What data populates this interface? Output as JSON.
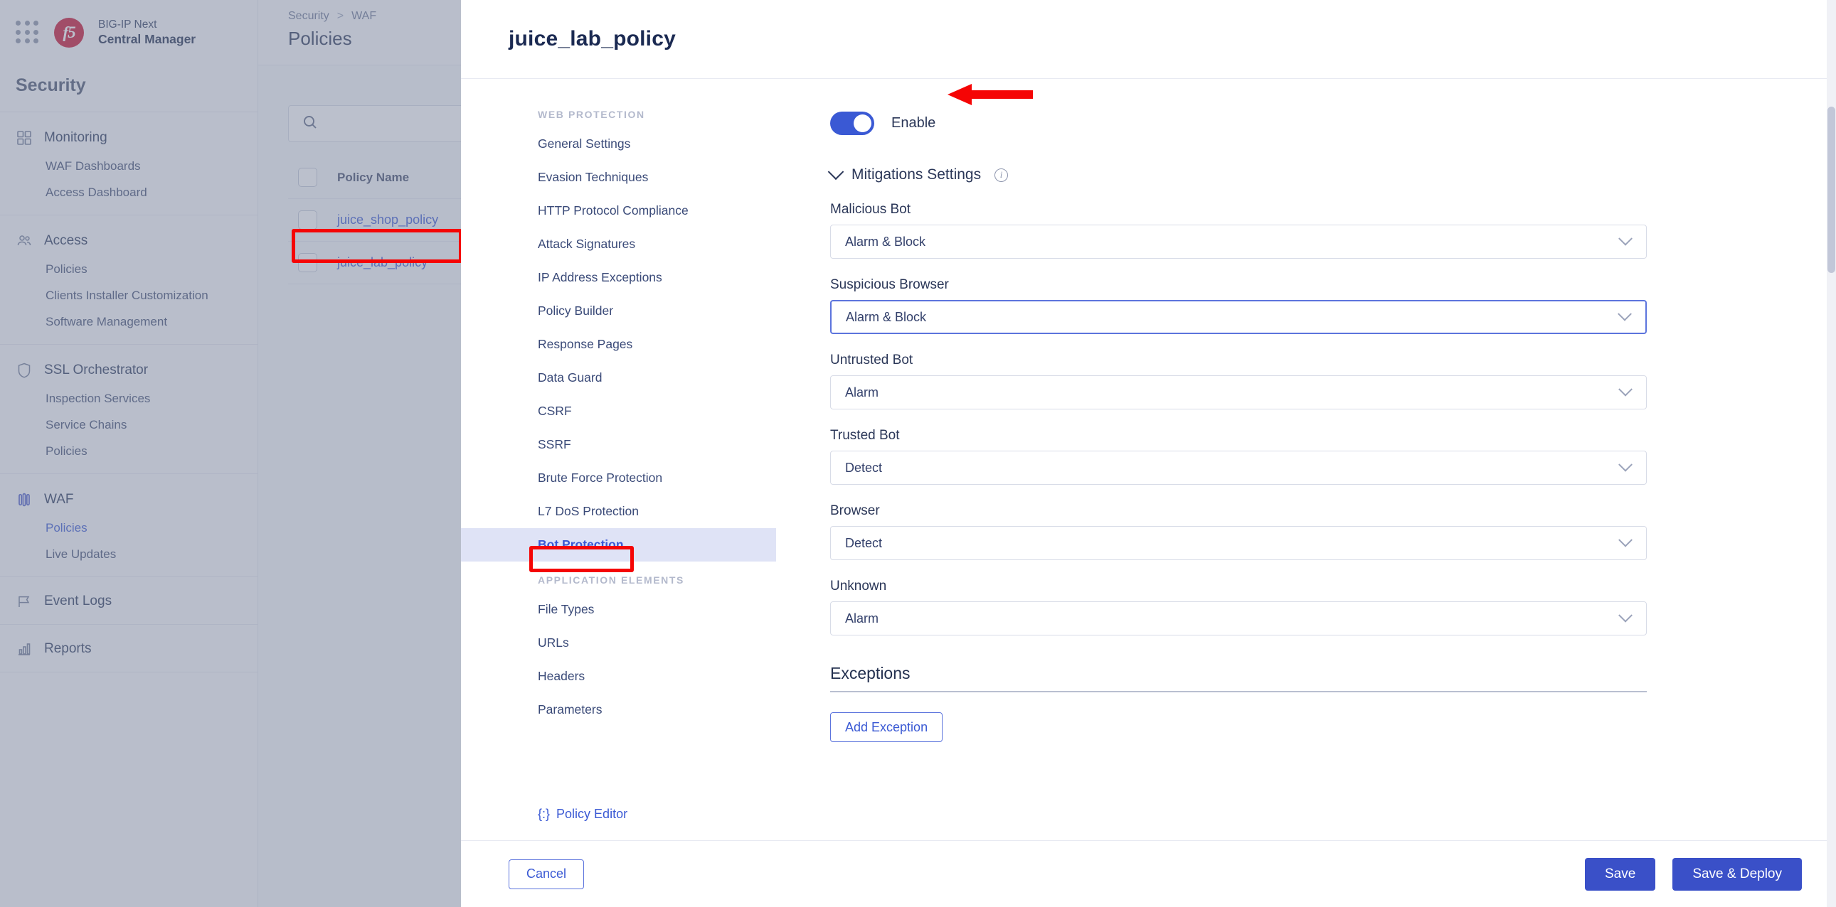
{
  "brand": {
    "logo": "f5",
    "line1": "BIG-IP Next",
    "line2": "Central Manager"
  },
  "sidebar": {
    "title": "Security",
    "groups": [
      {
        "icon": "grid-icon",
        "label": "Monitoring",
        "items": [
          {
            "label": "WAF Dashboards",
            "active": false
          },
          {
            "label": "Access Dashboard",
            "active": false
          }
        ]
      },
      {
        "icon": "users-icon",
        "label": "Access",
        "items": [
          {
            "label": "Policies",
            "active": false
          },
          {
            "label": "Clients Installer Customization",
            "active": false
          },
          {
            "label": "Software Management",
            "active": false
          }
        ]
      },
      {
        "icon": "shield-icon",
        "label": "SSL Orchestrator",
        "items": [
          {
            "label": "Inspection Services",
            "active": false
          },
          {
            "label": "Service Chains",
            "active": false
          },
          {
            "label": "Policies",
            "active": false
          }
        ]
      },
      {
        "icon": "waf-icon",
        "label": "WAF",
        "items": [
          {
            "label": "Policies",
            "active": true
          },
          {
            "label": "Live Updates",
            "active": false
          }
        ]
      },
      {
        "icon": "flag-icon",
        "label": "Event Logs",
        "items": []
      },
      {
        "icon": "bar-chart-icon",
        "label": "Reports",
        "items": []
      }
    ]
  },
  "background_page": {
    "breadcrumb": [
      "Security",
      "WAF"
    ],
    "breadcrumb_separator": ">",
    "page_title": "Policies",
    "search": {
      "value": "",
      "placeholder": "",
      "icon": "search-icon"
    },
    "table": {
      "columns": [
        "Policy Name"
      ],
      "rows": [
        {
          "name": "juice_shop_policy",
          "highlighted": false
        },
        {
          "name": "juice_lab_policy",
          "highlighted": true
        }
      ]
    }
  },
  "modal": {
    "title": "juice_lab_policy",
    "nav": [
      {
        "section": "WEB PROTECTION",
        "items": [
          {
            "label": "General Settings",
            "selected": false
          },
          {
            "label": "Evasion Techniques",
            "selected": false
          },
          {
            "label": "HTTP Protocol Compliance",
            "selected": false
          },
          {
            "label": "Attack Signatures",
            "selected": false
          },
          {
            "label": "IP Address Exceptions",
            "selected": false
          },
          {
            "label": "Policy Builder",
            "selected": false
          },
          {
            "label": "Response Pages",
            "selected": false
          },
          {
            "label": "Data Guard",
            "selected": false
          },
          {
            "label": "CSRF",
            "selected": false
          },
          {
            "label": "SSRF",
            "selected": false
          },
          {
            "label": "Brute Force Protection",
            "selected": false
          },
          {
            "label": "L7 DoS Protection",
            "selected": false
          },
          {
            "label": "Bot Protection",
            "selected": true
          }
        ]
      },
      {
        "section": "APPLICATION ELEMENTS",
        "items": [
          {
            "label": "File Types",
            "selected": false
          },
          {
            "label": "URLs",
            "selected": false
          },
          {
            "label": "Headers",
            "selected": false
          },
          {
            "label": "Parameters",
            "selected": false
          }
        ]
      }
    ],
    "policy_editor": {
      "label": "Policy Editor",
      "glyph": "{:}"
    },
    "content": {
      "enable": {
        "label": "Enable",
        "on": true
      },
      "mitigations": {
        "label": "Mitigations Settings",
        "expanded": true,
        "info_icon": "info-icon"
      },
      "fields": [
        {
          "label": "Malicious Bot",
          "value": "Alarm & Block",
          "focused": false
        },
        {
          "label": "Suspicious Browser",
          "value": "Alarm & Block",
          "focused": true
        },
        {
          "label": "Untrusted Bot",
          "value": "Alarm",
          "focused": false
        },
        {
          "label": "Trusted Bot",
          "value": "Detect",
          "focused": false
        },
        {
          "label": "Browser",
          "value": "Detect",
          "focused": false
        },
        {
          "label": "Unknown",
          "value": "Alarm",
          "focused": false
        }
      ],
      "exceptions": {
        "title": "Exceptions",
        "add_button": "Add Exception"
      }
    },
    "footer": {
      "cancel": "Cancel",
      "save": "Save",
      "save_deploy": "Save & Deploy"
    }
  },
  "annotations": {
    "arrow_color": "#f50505",
    "box_color": "#f50505",
    "targets": [
      "juice_lab_policy-row",
      "bot-protection-nav-item",
      "enable-toggle"
    ]
  }
}
